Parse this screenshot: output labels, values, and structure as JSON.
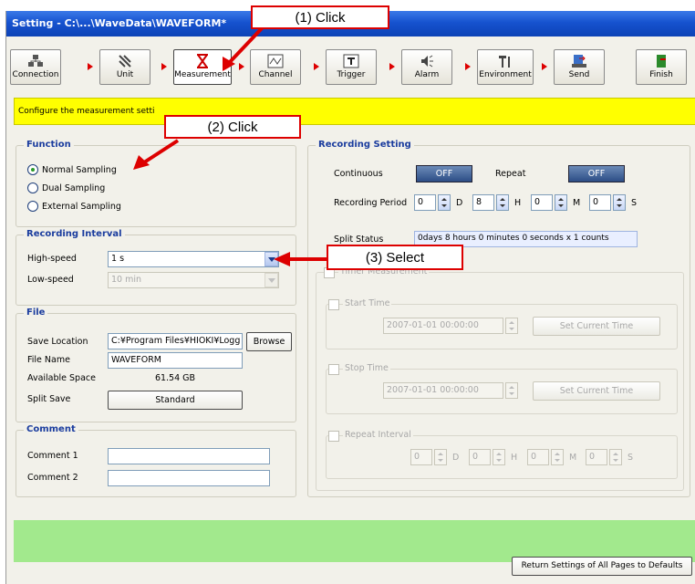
{
  "window": {
    "title": "Setting - C:\\...\\WaveData\\WAVEFORM*"
  },
  "toolbar": {
    "items": [
      {
        "label": "Connection",
        "icon": "connection-icon"
      },
      {
        "label": "Unit",
        "icon": "unit-icon"
      },
      {
        "label": "Measurement",
        "icon": "hourglass-icon",
        "selected": true
      },
      {
        "label": "Channel",
        "icon": "channel-icon"
      },
      {
        "label": "Trigger",
        "icon": "trigger-icon"
      },
      {
        "label": "Alarm",
        "icon": "alarm-icon"
      },
      {
        "label": "Environment",
        "icon": "environment-icon"
      },
      {
        "label": "Send",
        "icon": "send-icon"
      },
      {
        "label": "Finish",
        "icon": "finish-icon"
      }
    ]
  },
  "banner": {
    "text": "Configure the measurement setti"
  },
  "function": {
    "title": "Function",
    "options": [
      "Normal Sampling",
      "Dual Sampling",
      "External Sampling"
    ],
    "selected": "Normal Sampling"
  },
  "recording_interval": {
    "title": "Recording Interval",
    "high_speed_label": "High-speed",
    "high_speed_value": "1 s",
    "low_speed_label": "Low-speed",
    "low_speed_value": "10 min"
  },
  "file": {
    "title": "File",
    "save_location_label": "Save Location",
    "save_location_value": "C:¥Program Files¥HIOKI¥Logg",
    "browse_label": "Browse",
    "file_name_label": "File Name",
    "file_name_value": "WAVEFORM",
    "available_space_label": "Available Space",
    "available_space_value": "61.54 GB",
    "split_save_label": "Split Save",
    "split_save_value": "Standard"
  },
  "comment": {
    "title": "Comment",
    "comment1_label": "Comment 1",
    "comment1_value": "",
    "comment2_label": "Comment 2",
    "comment2_value": ""
  },
  "recording_setting": {
    "title": "Recording Setting",
    "continuous_label": "Continuous",
    "continuous_value": "OFF",
    "repeat_label": "Repeat",
    "repeat_value": "OFF",
    "period_label": "Recording Period",
    "period": {
      "d": "0",
      "h": "8",
      "m": "0",
      "s": "0"
    },
    "unit_d": "D",
    "unit_h": "H",
    "unit_m": "M",
    "unit_s": "S",
    "split_status_label": "Split Status",
    "split_status_value": "0days 8 hours 0 minutes 0 seconds x 1 counts"
  },
  "timer": {
    "timer_label": "Timer Measurement",
    "start_label": "Start Time",
    "start_value": "2007-01-01 00:00:00",
    "start_btn": "Set Current Time",
    "stop_label": "Stop Time",
    "stop_value": "2007-01-01 00:00:00",
    "stop_btn": "Set Current Time",
    "repeat_interval_label": "Repeat Interval",
    "ri": {
      "d": "0",
      "h": "0",
      "m": "0",
      "s": "0"
    },
    "unit_d": "D",
    "unit_h": "H",
    "unit_m": "M",
    "unit_s": "S"
  },
  "footer": {
    "defaults_button": "Return Settings of All Pages to Defaults"
  },
  "callouts": {
    "c1": "(1) Click",
    "c2": "(2) Click",
    "c3": "(3) Select"
  },
  "colors": {
    "accent_red": "#dd0000",
    "banner": "#ffff00",
    "green_bar": "#a2e98d"
  }
}
